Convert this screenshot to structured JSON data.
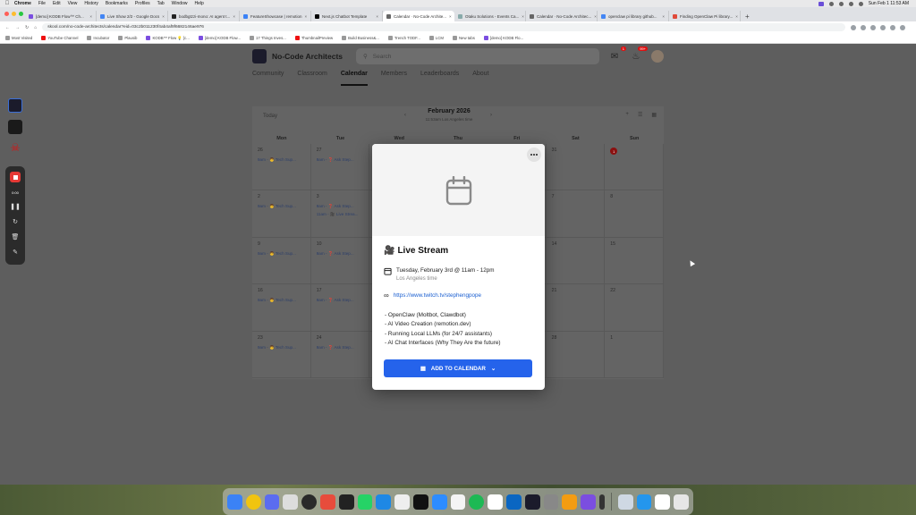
{
  "menubar": {
    "app": "Chrome",
    "items": [
      "File",
      "Edit",
      "View",
      "History",
      "Bookmarks",
      "Profiles",
      "Tab",
      "Window",
      "Help"
    ],
    "clock": "Sun Feb 1  11:53 AM"
  },
  "tabs": [
    {
      "label": "[demo] KODB Flow™ Ch...",
      "active": false
    },
    {
      "label": "Live Show 2/2 - Google Docs",
      "active": false
    },
    {
      "label": "bodbgtzzi-mono: AI agent t...",
      "active": false
    },
    {
      "label": "FeatureShowcase | remotion",
      "active": false
    },
    {
      "label": "Next.js Chatbot Template",
      "active": false
    },
    {
      "label": "Calendar · No-Code Archite...",
      "active": true
    },
    {
      "label": "Otaku Solutions - Events Ca...",
      "active": false
    },
    {
      "label": "Calendar · No-Code Architec...",
      "active": false
    },
    {
      "label": "openclaw pi library github...",
      "active": false
    },
    {
      "label": "Finding OpenClaw Pi library...",
      "active": false
    }
  ],
  "address": {
    "url": "skool.com/no-code-architects/calendar?eid=03c2b011230f4ab4af9f6682146ae976"
  },
  "bookmarks": [
    "Most Visited",
    "YouTube Channel",
    "Incubator",
    "Plausib",
    "KODB™ Flow 💡 [c...",
    "[demo] KODB Flow...",
    "17 Things Inves...",
    "ThumbnailPreview",
    "Build Business&...",
    "Trench TODF...",
    "LCM",
    "New tabs",
    "[demo] KODB Flo..."
  ],
  "group": {
    "name": "No-Code Architects",
    "search_placeholder": "Search",
    "chat_badge": "1",
    "notif_badge": "99+"
  },
  "nav": {
    "tabs": [
      "Community",
      "Classroom",
      "Calendar",
      "Members",
      "Leaderboards",
      "About"
    ],
    "active_index": 2
  },
  "calendar": {
    "today_label": "Today",
    "month": "February 2026",
    "timezone": "11:53am Los Angeles time",
    "days": [
      "Mon",
      "Tue",
      "Wed",
      "Thu",
      "Fri",
      "Sat",
      "Sun"
    ],
    "weeks": [
      [
        {
          "d": "26",
          "ev": [
            "9am - 👨 Tech Sup..."
          ]
        },
        {
          "d": "27",
          "ev": [
            "9am - ❓ Ask Step..."
          ]
        },
        {
          "d": "",
          "ev": []
        },
        {
          "d": "",
          "ev": []
        },
        {
          "d": "",
          "ev": []
        },
        {
          "d": "31",
          "ev": []
        },
        {
          "d": "1",
          "ev": [],
          "today": true
        }
      ],
      [
        {
          "d": "2",
          "ev": [
            "9am - 👨 Tech Sup..."
          ]
        },
        {
          "d": "3",
          "ev": [
            "9am - ❓ Ask Step...",
            "11am - 🎥 Live Strea..."
          ]
        },
        {
          "d": "",
          "ev": []
        },
        {
          "d": "",
          "ev": []
        },
        {
          "d": "",
          "ev": []
        },
        {
          "d": "7",
          "ev": []
        },
        {
          "d": "8",
          "ev": []
        }
      ],
      [
        {
          "d": "9",
          "ev": [
            "9am - 👨 Tech Sup..."
          ]
        },
        {
          "d": "10",
          "ev": [
            "9am - ❓ Ask Step..."
          ]
        },
        {
          "d": "",
          "ev": []
        },
        {
          "d": "",
          "ev": []
        },
        {
          "d": "",
          "ev": []
        },
        {
          "d": "14",
          "ev": []
        },
        {
          "d": "15",
          "ev": []
        }
      ],
      [
        {
          "d": "16",
          "ev": [
            "9am - 👨 Tech Sup..."
          ]
        },
        {
          "d": "17",
          "ev": [
            "9am - ❓ Ask Step..."
          ]
        },
        {
          "d": "",
          "ev": []
        },
        {
          "d": "",
          "ev": []
        },
        {
          "d": "",
          "ev": []
        },
        {
          "d": "21",
          "ev": []
        },
        {
          "d": "22",
          "ev": []
        }
      ],
      [
        {
          "d": "23",
          "ev": [
            "9am - 👨 Tech Sup..."
          ]
        },
        {
          "d": "24",
          "ev": [
            "9am - ❓ Ask Step..."
          ]
        },
        {
          "d": "",
          "ev": []
        },
        {
          "d": "",
          "ev": []
        },
        {
          "d": "",
          "ev": []
        },
        {
          "d": "28",
          "ev": []
        },
        {
          "d": "1",
          "ev": []
        }
      ]
    ]
  },
  "recorder": {
    "time": "0:00"
  },
  "modal": {
    "title_emoji": "🎥",
    "title": "Live Stream",
    "date": "Tuesday, February 3rd @ 11am - 12pm",
    "timezone": "Los Angeles time",
    "link": "https://www.twitch.tv/stephengpope",
    "description": [
      "- OpenClaw (Moltbot, Clawdbot)",
      "- AI Video Creation (remotion.dev)",
      "- Running Local LLMs (for 24/7 assistants)",
      "- AI Chat Interfaces (Why They Are the future)"
    ],
    "add_button": "ADD TO CALENDAR"
  },
  "colors": {
    "accent": "#2563eb",
    "link": "#1a5fd1",
    "rec_red": "#e53935"
  }
}
